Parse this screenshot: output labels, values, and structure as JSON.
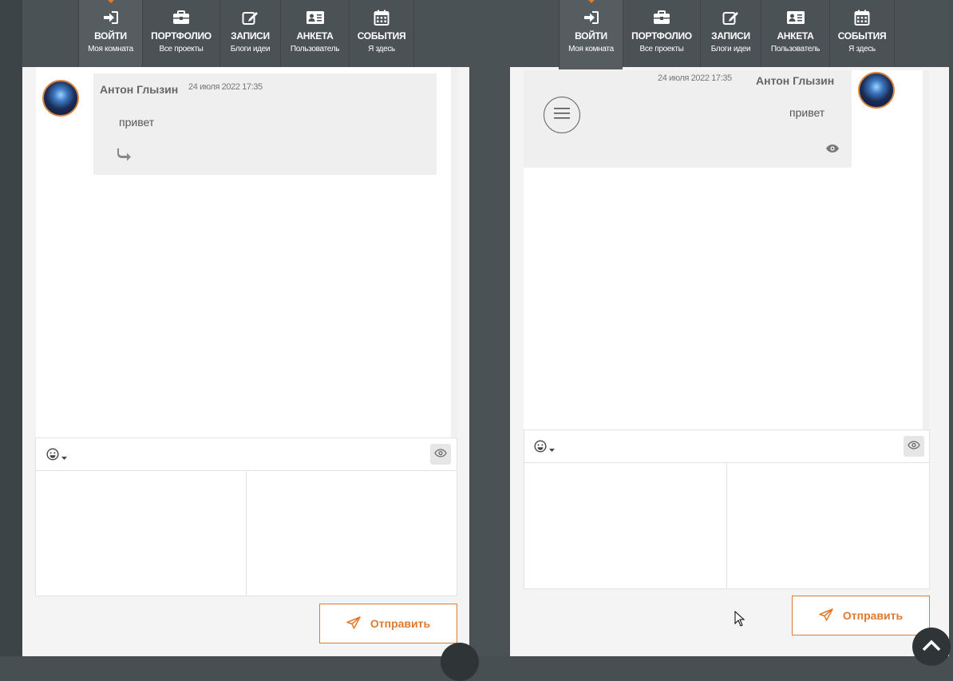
{
  "nav": {
    "items": [
      {
        "title": "ВОЙТИ",
        "subtitle": "Моя комната",
        "icon": "sign-in-icon",
        "active": true
      },
      {
        "title": "ПОРТФОЛИО",
        "subtitle": "Все проекты",
        "icon": "briefcase-icon"
      },
      {
        "title": "ЗАПИСИ",
        "subtitle": "Блоги идеи",
        "icon": "edit-icon"
      },
      {
        "title": "АНКЕТА",
        "subtitle": "Пользователь",
        "icon": "id-card-icon"
      },
      {
        "title": "СОБЫТИЯ",
        "subtitle": "Я здесь",
        "icon": "calendar-icon"
      }
    ]
  },
  "left_chat": {
    "message": {
      "author": "Антон Глызин",
      "date": "24 июля 2022 17:35",
      "text": "привет"
    },
    "send_label": "Отправить"
  },
  "right_chat": {
    "message": {
      "author": "Антон Глызин",
      "date": "24 июля 2022 17:35",
      "text": "привет"
    },
    "send_label": "Отправить"
  },
  "colors": {
    "accent": "#e07a2e",
    "nav_bg": "#4b5255",
    "page_bg": "#474f52"
  }
}
